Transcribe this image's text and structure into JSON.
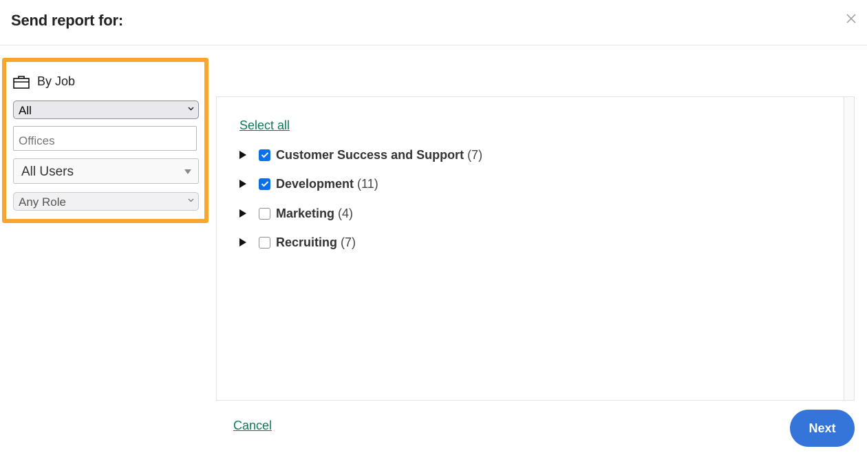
{
  "dialog": {
    "title": "Send report for:",
    "close_icon": "close-icon"
  },
  "filters": {
    "group_label": "By Job",
    "group_icon": "briefcase-icon",
    "highlight_color": "#f9a62f",
    "job_scope_select": {
      "value": "All"
    },
    "offices_input": {
      "value": "",
      "placeholder": "Offices"
    },
    "users_select": {
      "value": "All Users"
    },
    "role_select": {
      "value": "Any Role"
    }
  },
  "list": {
    "select_all_label": "Select all",
    "departments": [
      {
        "name": "Customer Success and Support",
        "count": "(7)",
        "checked": true
      },
      {
        "name": "Development",
        "count": "(11)",
        "checked": true
      },
      {
        "name": "Marketing",
        "count": "(4)",
        "checked": false
      },
      {
        "name": "Recruiting",
        "count": "(7)",
        "checked": false
      }
    ]
  },
  "footer": {
    "cancel_label": "Cancel",
    "next_label": "Next"
  },
  "colors": {
    "link": "#0b7a5b",
    "primary_button": "#3574d8",
    "checkbox_checked": "#0b70e6"
  }
}
